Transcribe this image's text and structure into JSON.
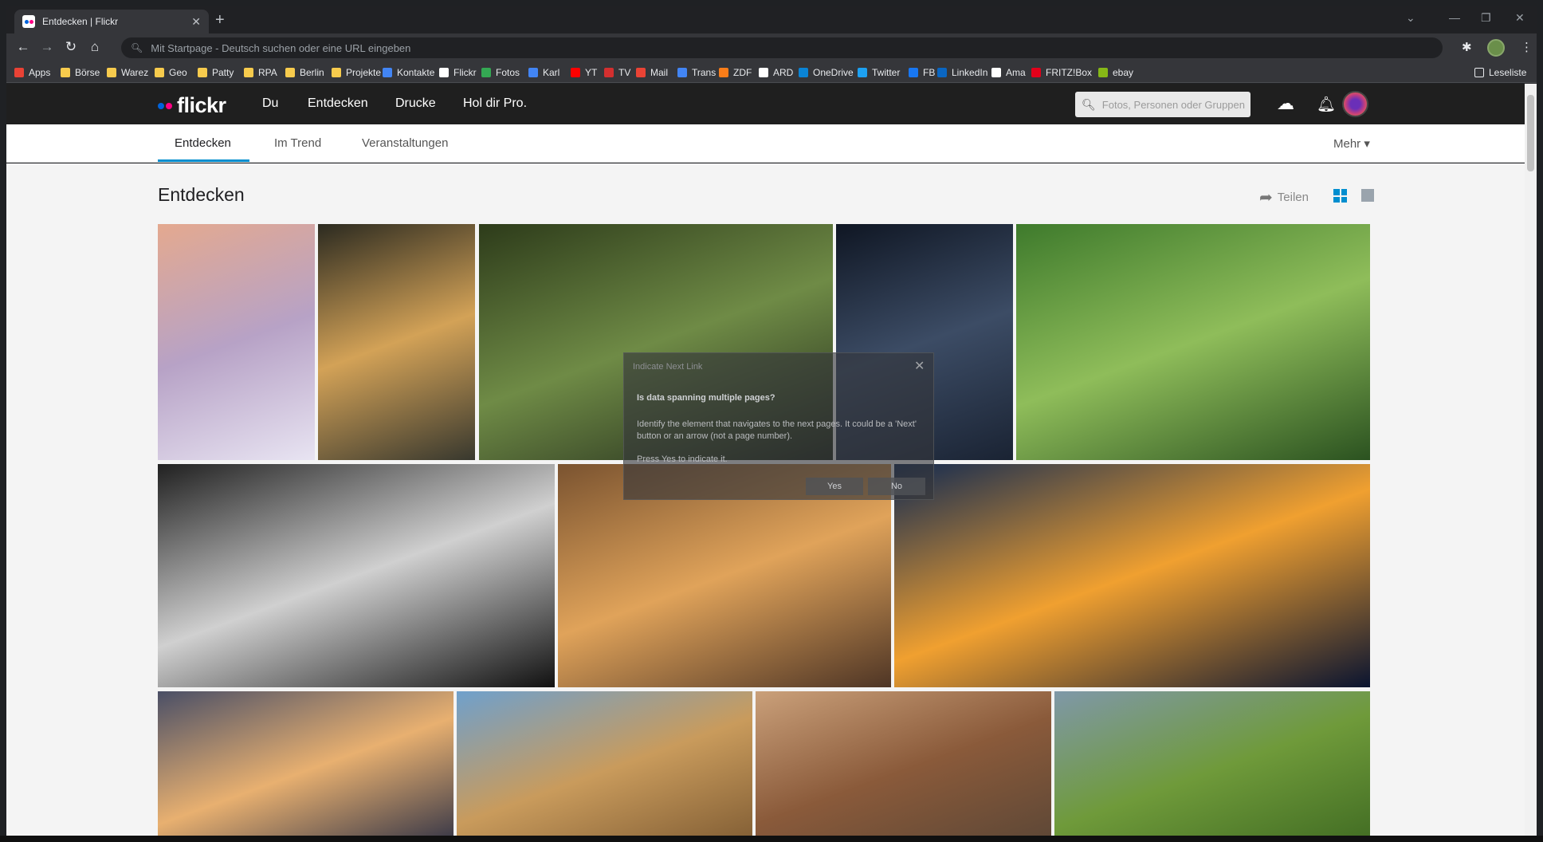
{
  "browser": {
    "tab_title": "Entdecken | Flickr",
    "tab_close": "✕",
    "new_tab": "+",
    "omnibox_placeholder": "Mit Startpage - Deutsch suchen oder eine URL eingeben",
    "window_controls": [
      "⌄",
      "—",
      "❐",
      "✕"
    ]
  },
  "bookmarks": [
    {
      "label": "Apps",
      "color": "#e94235"
    },
    {
      "label": "Börse",
      "color": "#f7cb4d"
    },
    {
      "label": "Warez",
      "color": "#f7cb4d"
    },
    {
      "label": "Geo",
      "color": "#f7cb4d"
    },
    {
      "label": "Patty",
      "color": "#f7cb4d"
    },
    {
      "label": "RPA",
      "color": "#f7cb4d"
    },
    {
      "label": "Berlin",
      "color": "#f7cb4d"
    },
    {
      "label": "Projekte",
      "color": "#f7cb4d"
    },
    {
      "label": "Kontakte",
      "color": "#4285f4"
    },
    {
      "label": "Flickr",
      "color": "#ffffff"
    },
    {
      "label": "Fotos",
      "color": "#34a853"
    },
    {
      "label": "Karl",
      "color": "#4285f4"
    },
    {
      "label": "YT",
      "color": "#ff0000"
    },
    {
      "label": "TV",
      "color": "#d32f2f"
    },
    {
      "label": "Mail",
      "color": "#ea4335"
    },
    {
      "label": "Trans",
      "color": "#4285f4"
    },
    {
      "label": "ZDF",
      "color": "#fa7d19"
    },
    {
      "label": "ARD",
      "color": "#ffffff"
    },
    {
      "label": "OneDrive",
      "color": "#0a84d6"
    },
    {
      "label": "Twitter",
      "color": "#1da1f2"
    },
    {
      "label": "FB",
      "color": "#1877f2"
    },
    {
      "label": "LinkedIn",
      "color": "#0a66c2"
    },
    {
      "label": "Ama",
      "color": "#ffffff"
    },
    {
      "label": "FRITZ!Box",
      "color": "#e2001a"
    },
    {
      "label": "ebay",
      "color": "#86b817"
    }
  ],
  "reading_list": "Leseliste",
  "flickr": {
    "logo": "flickr",
    "nav": [
      "Du",
      "Entdecken",
      "Drucke",
      "Hol dir Pro."
    ],
    "search_placeholder": "Fotos, Personen oder Gruppen",
    "subtabs": [
      "Entdecken",
      "Im Trend",
      "Veranstaltungen"
    ],
    "more": "Mehr ▾",
    "page_title": "Entdecken",
    "share": "Teilen"
  },
  "photos": [
    {
      "name": "photo-winter-trees",
      "colors": [
        "#e4a98f",
        "#b7a2c6",
        "#e8e4f2"
      ]
    },
    {
      "name": "photo-forest-sunbeams",
      "colors": [
        "#2b2a20",
        "#d3a257",
        "#38382e"
      ]
    },
    {
      "name": "photo-waterfall-fern",
      "colors": [
        "#2d3b1a",
        "#6f8b46",
        "#20281a"
      ]
    },
    {
      "name": "photo-child-lantern",
      "colors": [
        "#0f1623",
        "#3c4c65",
        "#1a2333"
      ]
    },
    {
      "name": "photo-butterfly",
      "colors": [
        "#3e7a2c",
        "#8fbd5a",
        "#2b5220"
      ]
    },
    {
      "name": "photo-street-bw",
      "colors": [
        "#202020",
        "#d0d0d0",
        "#111111"
      ]
    },
    {
      "name": "photo-autumn-river",
      "colors": [
        "#7a5330",
        "#e0a35a",
        "#4e3525"
      ]
    },
    {
      "name": "photo-lake-sunset",
      "colors": [
        "#132a50",
        "#f0a030",
        "#0a1430"
      ]
    },
    {
      "name": "photo-branches-sunset",
      "colors": [
        "#4a4f66",
        "#e8b070",
        "#2a2e44"
      ]
    },
    {
      "name": "photo-matera-town",
      "colors": [
        "#6fa0cc",
        "#c99b5c",
        "#7d5a32"
      ]
    },
    {
      "name": "photo-squirrel",
      "colors": [
        "#caa07a",
        "#8a5a3a",
        "#5a4636"
      ]
    },
    {
      "name": "photo-green-hills",
      "colors": [
        "#7f98a8",
        "#6f9a3a",
        "#3f6a22"
      ]
    }
  ],
  "dialog": {
    "title": "Indicate Next Link",
    "close": "✕",
    "question": "Is data spanning multiple pages?",
    "body": "Identify the element that navigates to the next pages. It could be a 'Next' button or an arrow (not a page number).",
    "press": "Press Yes to indicate it.",
    "yes": "Yes",
    "no": "No"
  }
}
